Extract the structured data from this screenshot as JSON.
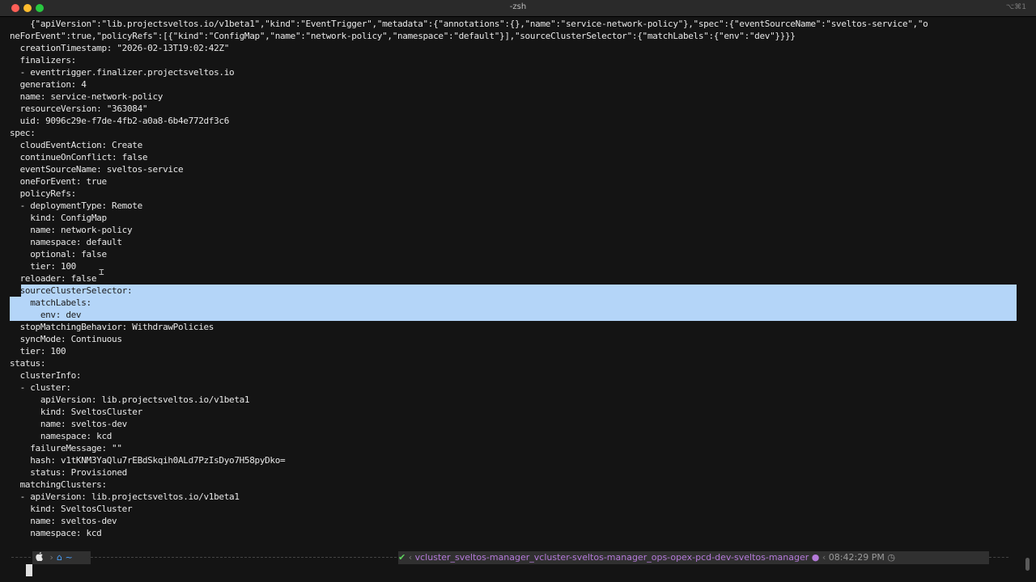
{
  "window": {
    "title": "-zsh",
    "shortcut": "⌥⌘1"
  },
  "terminal": {
    "lines": [
      "    {\"apiVersion\":\"lib.projectsveltos.io/v1beta1\",\"kind\":\"EventTrigger\",\"metadata\":{\"annotations\":{},\"name\":\"service-network-policy\"},\"spec\":{\"eventSourceName\":\"sveltos-service\",\"o",
      "neForEvent\":true,\"policyRefs\":[{\"kind\":\"ConfigMap\",\"name\":\"network-policy\",\"namespace\":\"default\"}],\"sourceClusterSelector\":{\"matchLabels\":{\"env\":\"dev\"}}}}",
      "  creationTimestamp: \"2026-02-13T19:02:42Z\"",
      "  finalizers:",
      "  - eventtrigger.finalizer.projectsveltos.io",
      "  generation: 4",
      "  name: service-network-policy",
      "  resourceVersion: \"363084\"",
      "  uid: 9096c29e-f7de-4fb2-a0a8-6b4e772df3c6",
      "spec:",
      "  cloudEventAction: Create",
      "  continueOnConflict: false",
      "  eventSourceName: sveltos-service",
      "  oneForEvent: true",
      "  policyRefs:",
      "  - deploymentType: Remote",
      "    kind: ConfigMap",
      "    name: network-policy",
      "    namespace: default",
      "    optional: false",
      "    tier: 100",
      "  reloader: false",
      "  sourceClusterSelector:",
      "    matchLabels:",
      "      env: dev",
      "  stopMatchingBehavior: WithdrawPolicies",
      "  syncMode: Continuous",
      "  tier: 100",
      "status:",
      "  clusterInfo:",
      "  - cluster:",
      "      apiVersion: lib.projectsveltos.io/v1beta1",
      "      kind: SveltosCluster",
      "      name: sveltos-dev",
      "      namespace: kcd",
      "    failureMessage: \"\"",
      "    hash: v1tKNM3YaQlu7rEBdSkqih0ALd7PzIsDyo7H58pyDko=",
      "    status: Provisioned",
      "  matchingClusters:",
      "  - apiVersion: lib.projectsveltos.io/v1beta1",
      "    kind: SveltosCluster",
      "    name: sveltos-dev",
      "    namespace: kcd"
    ],
    "selected_from": 22,
    "selected_to": 24
  },
  "prompt": {
    "apple_icon": "apple-icon",
    "home_dir": "~",
    "status_ok": "✔",
    "context": "vcluster_sveltos-manager_vcluster-sveltos-manager_ops-opex-pcd-dev-sveltos-manager",
    "time": "08:42:29 PM",
    "colors": {
      "ok": "#5fd35f",
      "context": "#b47ad9",
      "home": "#4aa3ff",
      "selection": "#b4d5f8"
    }
  }
}
